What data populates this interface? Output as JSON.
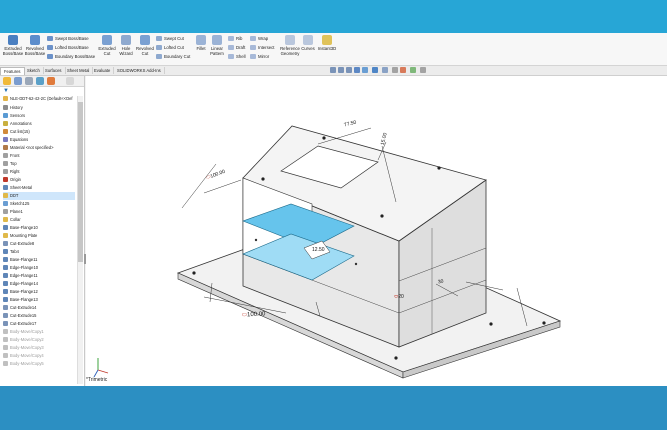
{
  "colors": {
    "accent": "#29a9d8",
    "selection": "#cfe6fb",
    "part_face": "#f1f1f1",
    "highlight": "#5bc2ea"
  },
  "ribbon": {
    "buttons": [
      {
        "label1": "Extruded",
        "label2": "Boss/Base",
        "icon": "extrude-boss-icon"
      },
      {
        "label1": "Revolved",
        "label2": "Boss/Base",
        "icon": "revolve-boss-icon"
      },
      {
        "label1": "Extruded",
        "label2": "Cut",
        "icon": "extrude-cut-icon"
      },
      {
        "label1": "Hole",
        "label2": "Wizard",
        "icon": "hole-wizard-icon"
      },
      {
        "label1": "Revolved",
        "label2": "Cut",
        "icon": "revolve-cut-icon"
      },
      {
        "label1": "Fillet",
        "label2": "",
        "icon": "fillet-icon"
      },
      {
        "label1": "Linear",
        "label2": "Pattern",
        "icon": "linear-pattern-icon"
      },
      {
        "label1": "Reference",
        "label2": "Geometry",
        "icon": "reference-geometry-icon"
      },
      {
        "label1": "Curves",
        "label2": "",
        "icon": "curves-icon"
      },
      {
        "label1": "Instant3D",
        "label2": "",
        "icon": "instant3d-icon"
      }
    ],
    "small": {
      "swept_boss": "Swept Boss/Base",
      "lofted_boss": "Lofted Boss/Base",
      "boundary_boss": "Boundary Boss/Base",
      "swept_cut": "Swept Cut",
      "lofted_cut": "Lofted Cut",
      "boundary_cut": "Boundary Cut",
      "rib": "Rib",
      "draft": "Draft",
      "shell": "Shell",
      "wrap": "Wrap",
      "intersect": "Intersect",
      "mirror": "Mirror"
    }
  },
  "tabs": [
    "Features",
    "Sketch",
    "Surfaces",
    "Sheet Metal",
    "Evaluate",
    "SOLIDWORKS Add-Ins"
  ],
  "tree": {
    "root": "NLE-DDT-62-42-2C  (Default<<Def",
    "items": [
      {
        "label": "History",
        "icon": "history-icon",
        "dim": false
      },
      {
        "label": "Sensors",
        "icon": "sensor-icon",
        "dim": false
      },
      {
        "label": "Annotations",
        "icon": "annotation-icon",
        "dim": false
      },
      {
        "label": "Cut list(15)",
        "icon": "cut-list-icon",
        "dim": false
      },
      {
        "label": "Equations",
        "icon": "equation-icon",
        "dim": false
      },
      {
        "label": "Material <not specified>",
        "icon": "material-icon",
        "dim": false
      },
      {
        "label": "Front",
        "icon": "plane-icon",
        "dim": false
      },
      {
        "label": "Top",
        "icon": "plane-icon",
        "dim": false
      },
      {
        "label": "Right",
        "icon": "plane-icon",
        "dim": false
      },
      {
        "label": "Origin",
        "icon": "origin-icon",
        "dim": false
      },
      {
        "label": "Sheet-Metal",
        "icon": "sheet-metal-icon",
        "dim": false
      },
      {
        "label": "DDT",
        "icon": "folder-icon",
        "dim": false,
        "sel": true
      },
      {
        "label": "Sketch125",
        "icon": "sketch-icon",
        "dim": false
      },
      {
        "label": "Plane1",
        "icon": "plane-icon",
        "dim": false
      },
      {
        "label": "Collar",
        "icon": "folder-icon",
        "dim": false
      },
      {
        "label": "Base-Flange10",
        "icon": "flange-icon",
        "dim": false
      },
      {
        "label": "Mounting Plate",
        "icon": "folder-icon",
        "dim": false
      },
      {
        "label": "Cut-Extrude8",
        "icon": "cut-icon",
        "dim": false
      },
      {
        "label": "Tab4",
        "icon": "tab-icon",
        "dim": false
      },
      {
        "label": "Base-Flange11",
        "icon": "flange-icon",
        "dim": false
      },
      {
        "label": "Edge-Flange10",
        "icon": "flange-icon",
        "dim": false
      },
      {
        "label": "Edge-Flange11",
        "icon": "flange-icon",
        "dim": false
      },
      {
        "label": "Edge-Flange14",
        "icon": "flange-icon",
        "dim": false
      },
      {
        "label": "Base-Flange12",
        "icon": "flange-icon",
        "dim": false
      },
      {
        "label": "Base-Flange13",
        "icon": "flange-icon",
        "dim": false
      },
      {
        "label": "Cut-Extrude14",
        "icon": "cut-icon",
        "dim": false
      },
      {
        "label": "Cut-Extrude15",
        "icon": "cut-icon",
        "dim": false
      },
      {
        "label": "Cut-Extrude17",
        "icon": "cut-icon",
        "dim": false
      },
      {
        "label": "Body-Move/Copy1",
        "icon": "body-move-icon",
        "dim": true
      },
      {
        "label": "Body-Move/Copy2",
        "icon": "body-move-icon",
        "dim": true
      },
      {
        "label": "Body-Move/Copy3",
        "icon": "body-move-icon",
        "dim": true
      },
      {
        "label": "Body-Move/Copy4",
        "icon": "body-move-icon",
        "dim": true
      },
      {
        "label": "Body-Move/Copy5",
        "icon": "body-move-icon",
        "dim": true
      }
    ]
  },
  "dimensions": {
    "d1": "100.00",
    "d2": "77.50",
    "d3": "15.00",
    "d4": "100.00",
    "d5": "12.50",
    "d6": "30",
    "d7": "20"
  },
  "view": {
    "label": "*Trimetric"
  }
}
